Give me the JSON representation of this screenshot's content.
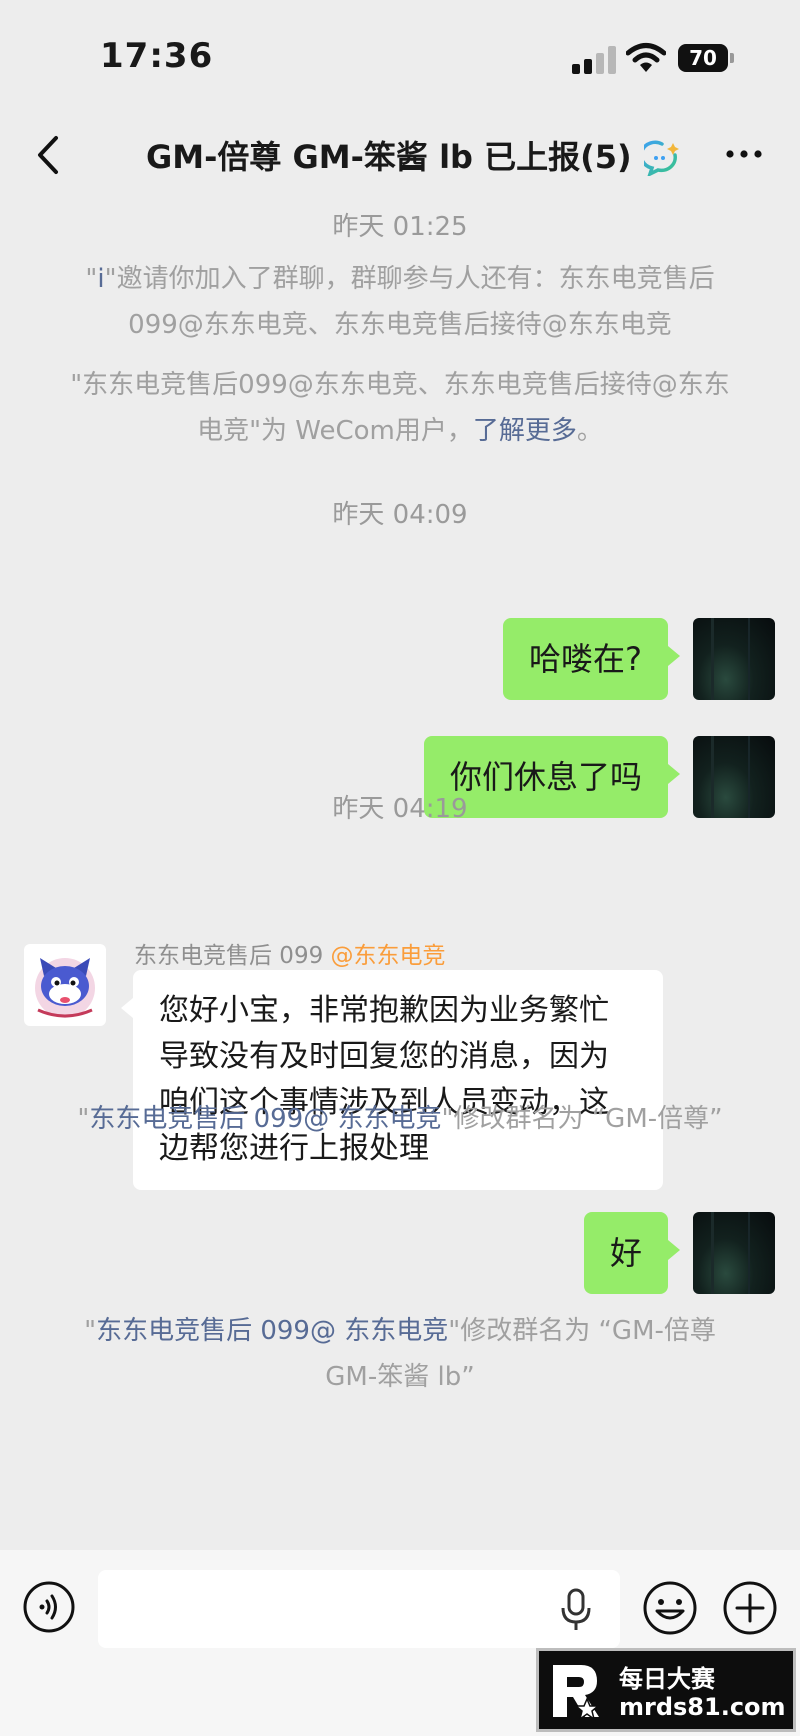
{
  "status_bar": {
    "time": "17:36",
    "battery": "70"
  },
  "header": {
    "title": "GM-倍尊 GM-笨酱  lb 已上报(5)"
  },
  "messages": {
    "time1": "昨天 01:25",
    "system1_prefix": "\"",
    "system1_name": "i",
    "system1_text": "\"邀请你加入了群聊，群聊参与人还有：东东电竞售后099@东东电竞、东东电竞售后接待@东东电竞",
    "system2_text": "\"东东电竞售后099@东东电竞、东东电竞售后接待@东东电竞\"为 WeCom用户，",
    "system2_link": "了解更多",
    "system2_end": "。",
    "time2": "昨天 04:09",
    "out1": "哈喽在?",
    "out2": "你们休息了吗",
    "time3": "昨天 04:19",
    "agent_name": "东东电竞售后 099 ",
    "agent_org": "@东东电竞",
    "in1": "您好小宝，非常抱歉因为业务繁忙导致没有及时回复您的消息，因为咱们这个事情涉及到人员变动，这边帮您进行上报处理",
    "rename1_q1": "\"",
    "rename1_actor": "东东电竞售后 099@ 东东电竞",
    "rename1_text": "\"修改群名为 “GM-倍尊”",
    "out3": "好",
    "rename2_q1": "\"",
    "rename2_actor": "东东电竞售后 099@ 东东电竞",
    "rename2_text": "\"修改群名为 “GM-倍尊 GM-笨酱  lb”"
  },
  "input": {
    "placeholder": ""
  },
  "watermark": {
    "line1": "每日大赛",
    "line2": "mrds81.com"
  },
  "colors": {
    "bubble_out": "#95ec69",
    "link": "#576b95",
    "org": "#fa9d3b",
    "background": "#ededed"
  },
  "icons": [
    "back-icon",
    "ai-assistant-icon",
    "more-icon",
    "voice-icon",
    "mic-icon",
    "emoji-icon",
    "plus-icon"
  ]
}
